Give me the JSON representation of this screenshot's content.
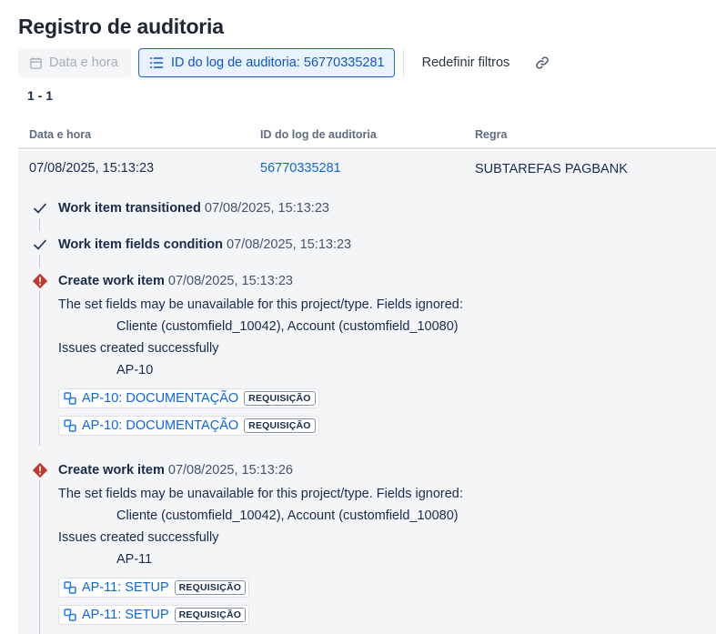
{
  "page": {
    "title": "Registro de auditoria"
  },
  "toolbar": {
    "date_filter_label": "Data e hora",
    "log_id_filter_label": "ID do log de auditoria: 56770335281",
    "reset_filters_label": "Redefinir filtros",
    "link_icon": "link-icon"
  },
  "results": {
    "count": "1 - 1"
  },
  "table": {
    "columns": [
      "Data e hora",
      "ID do log de auditoria",
      "Regra"
    ],
    "row": {
      "date": "07/08/2025, 15:13:23",
      "log_id": "56770335281",
      "rule": "SUBTAREFAS PAGBANK"
    }
  },
  "entries": [
    {
      "status": "success",
      "icon": "check-icon",
      "title": "Work item transitioned",
      "time": "07/08/2025, 15:13:23"
    },
    {
      "status": "success",
      "icon": "check-icon",
      "title": "Work item fields condition",
      "time": "07/08/2025, 15:13:23"
    },
    {
      "status": "error",
      "icon": "error-icon",
      "title": "Create work item",
      "time": "07/08/2025, 15:13:23",
      "message": "The set fields may be unavailable for this project/type. Fields ignored:",
      "fields": "Cliente (customfield_10042), Account (customfield_10080)",
      "created_label": "Issues created successfully",
      "created_key": "AP-10",
      "issues": [
        {
          "key": "AP-10: DOCUMENTAÇÃO",
          "type": "REQUISIÇÃO",
          "icon": "subtask-icon"
        },
        {
          "key": "AP-10: DOCUMENTAÇÃO",
          "type": "REQUISIÇÃO",
          "icon": "subtask-icon"
        }
      ]
    },
    {
      "status": "error",
      "icon": "error-icon",
      "title": "Create work item",
      "time": "07/08/2025, 15:13:26",
      "message": "The set fields may be unavailable for this project/type. Fields ignored:",
      "fields": "Cliente (customfield_10042), Account (customfield_10080)",
      "created_label": "Issues created successfully",
      "created_key": "AP-11",
      "issues": [
        {
          "key": "AP-11: SETUP",
          "type": "REQUISIÇÃO",
          "icon": "subtask-icon"
        },
        {
          "key": "AP-11: SETUP",
          "type": "REQUISIÇÃO",
          "icon": "subtask-icon"
        }
      ]
    }
  ],
  "colors": {
    "accent": "#0c66e4",
    "error": "#c9372c",
    "panel_bg": "#f4f5f7"
  }
}
